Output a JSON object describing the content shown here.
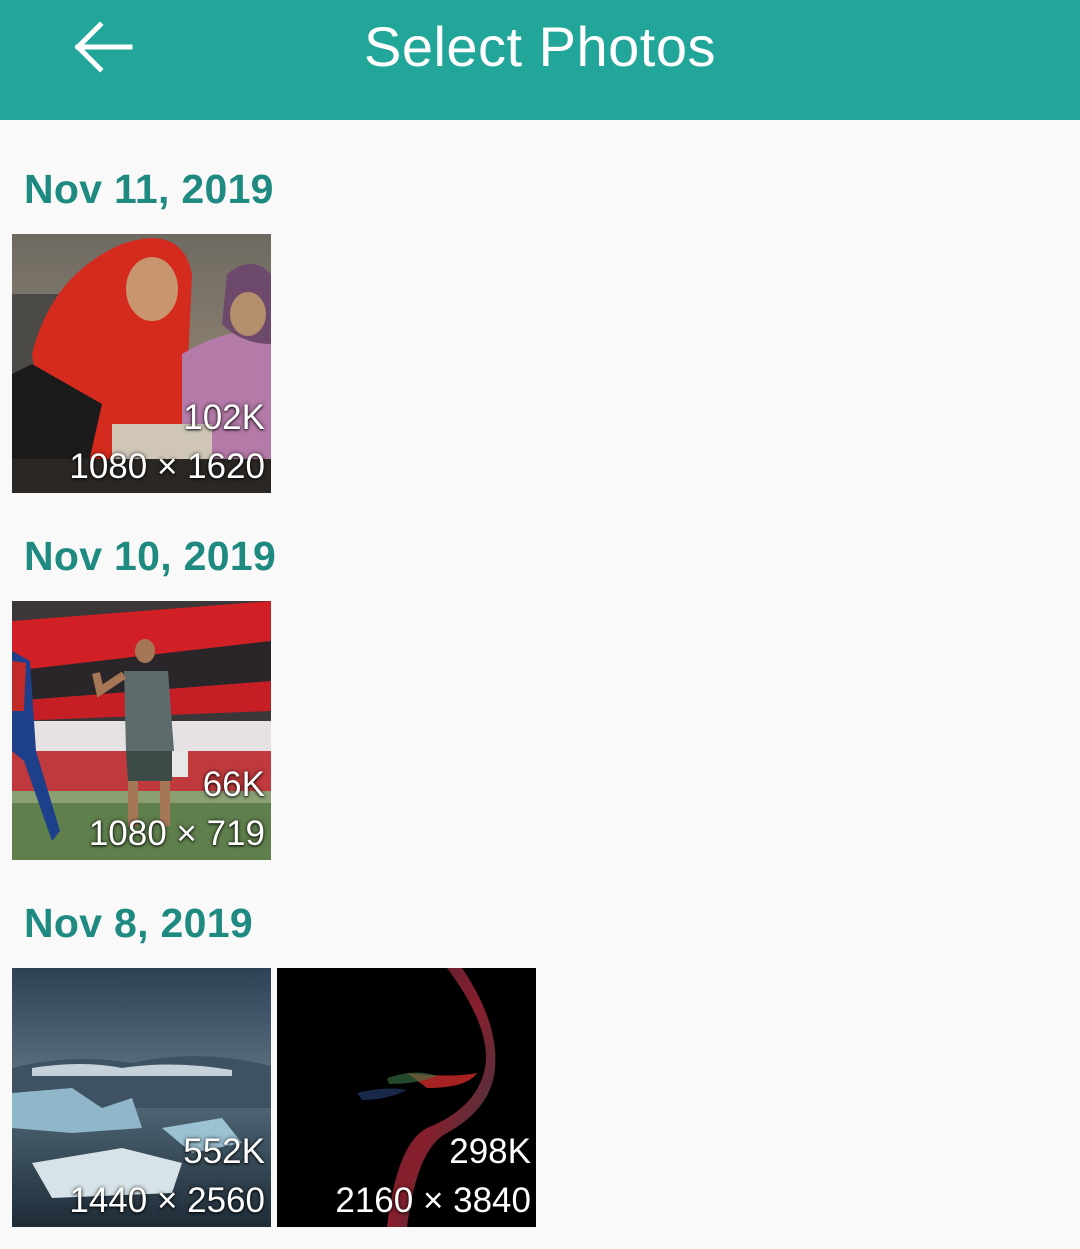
{
  "header": {
    "title": "Select Photos",
    "back_icon": "arrow-left-icon",
    "background_color": "#22a699"
  },
  "groups": [
    {
      "date": "Nov 11, 2019",
      "photos": [
        {
          "size": "102K",
          "dimensions": "1080 × 1620"
        }
      ]
    },
    {
      "date": "Nov 10, 2019",
      "photos": [
        {
          "size": "66K",
          "dimensions": "1080 × 719"
        }
      ]
    },
    {
      "date": "Nov 8, 2019",
      "photos": [
        {
          "size": "552K",
          "dimensions": "1440 × 2560"
        },
        {
          "size": "298K",
          "dimensions": "2160 × 3840"
        }
      ]
    }
  ],
  "accent_color": "#1e8a80"
}
